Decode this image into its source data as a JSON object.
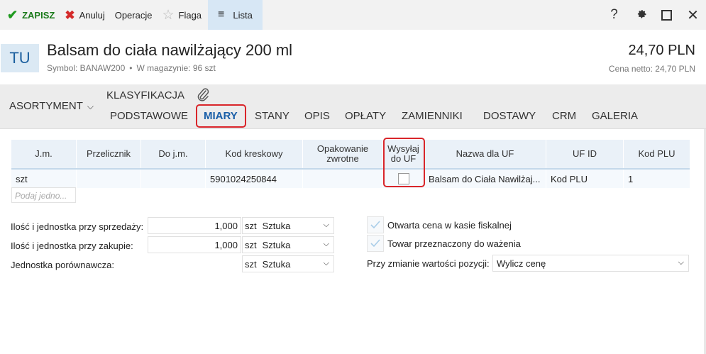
{
  "toolbar": {
    "save": "ZAPISZ",
    "cancel": "Anuluj",
    "operations": "Operacje",
    "flag": "Flaga",
    "list": "Lista",
    "help": "?"
  },
  "header": {
    "badge": "TU",
    "title": "Balsam do ciała nawilżający 200 ml",
    "symbol": "Symbol: BANAW200",
    "stock": "W magazynie: 96 szt",
    "price": "24,70 PLN",
    "net_price": "Cena netto: 24,70 PLN"
  },
  "nav": {
    "assortment": "ASORTYMENT",
    "classification": "KLASYFIKACJA",
    "tabs": [
      "PODSTAWOWE",
      "MIARY",
      "STANY",
      "OPIS",
      "OPŁATY",
      "ZAMIENNIKI",
      "DOSTAWY",
      "CRM",
      "GALERIA"
    ],
    "active_tab": "MIARY"
  },
  "grid": {
    "columns": [
      "J.m.",
      "Przelicznik",
      "Do j.m.",
      "Kod kreskowy",
      "Opakowanie zwrotne",
      "Wysyłaj do UF",
      "Nazwa dla UF",
      "UF ID",
      "Kod PLU"
    ],
    "rows": [
      {
        "jm": "szt",
        "przelicznik": "",
        "do_jm": "",
        "kod": "5901024250844",
        "opakowanie": "",
        "wysylaj": false,
        "nazwa": "Balsam do Ciała Nawilżaj...",
        "uf_id": "Kod PLU",
        "plu": "1"
      }
    ],
    "add_placeholder": "Podaj jedno..."
  },
  "form": {
    "sale_label": "Ilość i jednostka przy sprzedaży:",
    "sale_qty": "1,000",
    "sale_unit_short": "szt",
    "sale_unit": "Sztuka",
    "purchase_label": "Ilość i jednostka przy zakupie:",
    "purchase_qty": "1,000",
    "purchase_unit_short": "szt",
    "purchase_unit": "Sztuka",
    "compare_label": "Jednostka porównawcza:",
    "compare_unit_short": "szt",
    "compare_unit": "Sztuka",
    "open_price_label": "Otwarta cena w kasie fiskalnej",
    "weighing_label": "Towar przeznaczony do ważenia",
    "change_label": "Przy zmianie wartości pozycji:",
    "change_value": "Wylicz cenę"
  }
}
